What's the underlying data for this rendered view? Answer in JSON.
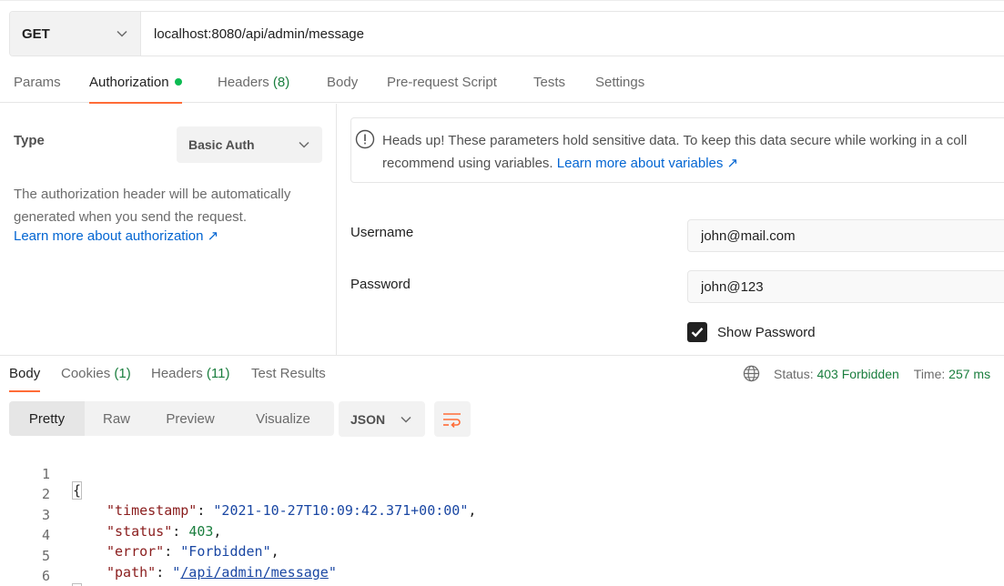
{
  "request": {
    "method": "GET",
    "url": "localhost:8080/api/admin/message"
  },
  "request_tabs": [
    {
      "label": "Params"
    },
    {
      "label": "Authorization"
    },
    {
      "label": "Headers",
      "count": "(8)"
    },
    {
      "label": "Body"
    },
    {
      "label": "Pre-request Script"
    },
    {
      "label": "Tests"
    },
    {
      "label": "Settings"
    }
  ],
  "auth": {
    "type_label": "Type",
    "type_value": "Basic Auth",
    "description": "The authorization header will be automatically generated when you send the request.",
    "learn_more": "Learn more about authorization ↗",
    "notice_line1": "Heads up! These parameters hold sensitive data. To keep this data secure while working in a coll",
    "notice_line2": "recommend using variables. ",
    "notice_link": "Learn more about variables ↗",
    "username_label": "Username",
    "username_value": "john@mail.com",
    "password_label": "Password",
    "password_value": "john@123",
    "show_password_label": "Show Password",
    "show_password_checked": true
  },
  "response_tabs": [
    {
      "label": "Body"
    },
    {
      "label": "Cookies",
      "count": "(1)"
    },
    {
      "label": "Headers",
      "count": "(11)"
    },
    {
      "label": "Test Results"
    }
  ],
  "status": {
    "status_label": "Status:",
    "status_value": "403 Forbidden",
    "time_label": "Time:",
    "time_value": "257 ms"
  },
  "view_modes": [
    "Pretty",
    "Raw",
    "Preview",
    "Visualize"
  ],
  "format": "JSON",
  "response_body": {
    "line_numbers": [
      "1",
      "2",
      "3",
      "4",
      "5",
      "6"
    ],
    "open_brace": "{",
    "close_brace": "}",
    "timestamp_key": "\"timestamp\"",
    "timestamp_value": "\"2021-10-27T10:09:42.371+00:00\"",
    "status_key": "\"status\"",
    "status_value": "403",
    "error_key": "\"error\"",
    "error_value": "\"Forbidden\"",
    "path_key": "\"path\"",
    "path_value": "/api/admin/message"
  },
  "colors": {
    "accent": "#ff6c37",
    "link": "#0265d2",
    "success": "#1a7e3e",
    "active_dot": "#0cbb52"
  }
}
